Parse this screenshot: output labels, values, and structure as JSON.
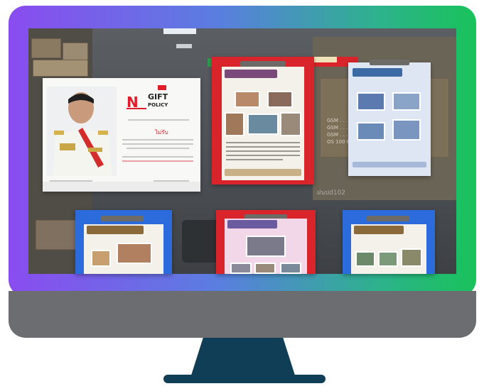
{
  "poster": {
    "no_text": "N",
    "gift_text": "GIFT",
    "policy_text": "POLICY",
    "accept_text": "ไม่รับ"
  },
  "wall_text": "ฝนปd102",
  "colors": {
    "frame_gradient": [
      "#8a4cf0",
      "#5a7ee0",
      "#2cb38a",
      "#19c25a"
    ],
    "bezel": "#6b6d70",
    "stand": "#0f3e56",
    "board_red": "#d8242a",
    "board_blue": "#2c6bdc"
  }
}
